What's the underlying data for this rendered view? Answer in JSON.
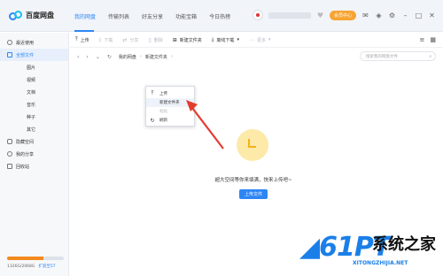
{
  "app": {
    "name": "百度网盘"
  },
  "nav": {
    "tabs": [
      "我的网盘",
      "传输列表",
      "好友分享",
      "功能宝箱",
      "今日热榜"
    ],
    "active_index": 0
  },
  "header": {
    "vip_label": "会员中心"
  },
  "sidebar": {
    "items": [
      {
        "label": "最近使用",
        "icon": "clock-icon"
      },
      {
        "label": "全部文件",
        "icon": "folder-icon",
        "active": true
      },
      {
        "label": "图片",
        "sub": true
      },
      {
        "label": "视频",
        "sub": true
      },
      {
        "label": "文档",
        "sub": true
      },
      {
        "label": "音乐",
        "sub": true
      },
      {
        "label": "种子",
        "sub": true
      },
      {
        "label": "其它",
        "sub": true
      },
      {
        "label": "隐藏空间",
        "icon": "lock-icon"
      },
      {
        "label": "我的分享",
        "icon": "share-icon"
      },
      {
        "label": "回收站",
        "icon": "trash-icon"
      }
    ],
    "storage": {
      "used_text": "1326G/2068G",
      "expand_label": "扩容至5T",
      "fraction": 0.64
    }
  },
  "toolbar": {
    "upload": "上传",
    "download": "下载",
    "share": "分享",
    "delete": "删除",
    "new_folder": "新建文件夹",
    "offline_download": "离线下载",
    "more": "更多"
  },
  "path": {
    "crumbs": [
      "我的网盘",
      "新建文件夹"
    ],
    "search_placeholder": "搜索我的网盘文件"
  },
  "context_menu": {
    "items": [
      {
        "label": "上传",
        "icon": "upload-icon"
      },
      {
        "label": "新建文件夹",
        "icon": "",
        "highlighted": true
      },
      {
        "label": "粘贴",
        "icon": "",
        "disabled": true
      },
      {
        "label": "刷新",
        "icon": "refresh-icon"
      }
    ]
  },
  "empty_state": {
    "message": "超大空间等你来填满，快来上传吧~",
    "button": "上传文件"
  },
  "watermark": {
    "logo": "系统之家",
    "url": "XITONGZHIJIA.NET"
  },
  "colors": {
    "accent": "#2e86f5",
    "vip": "#f7a433",
    "storage": "#f28a20",
    "arrow": "#e23d2f"
  }
}
